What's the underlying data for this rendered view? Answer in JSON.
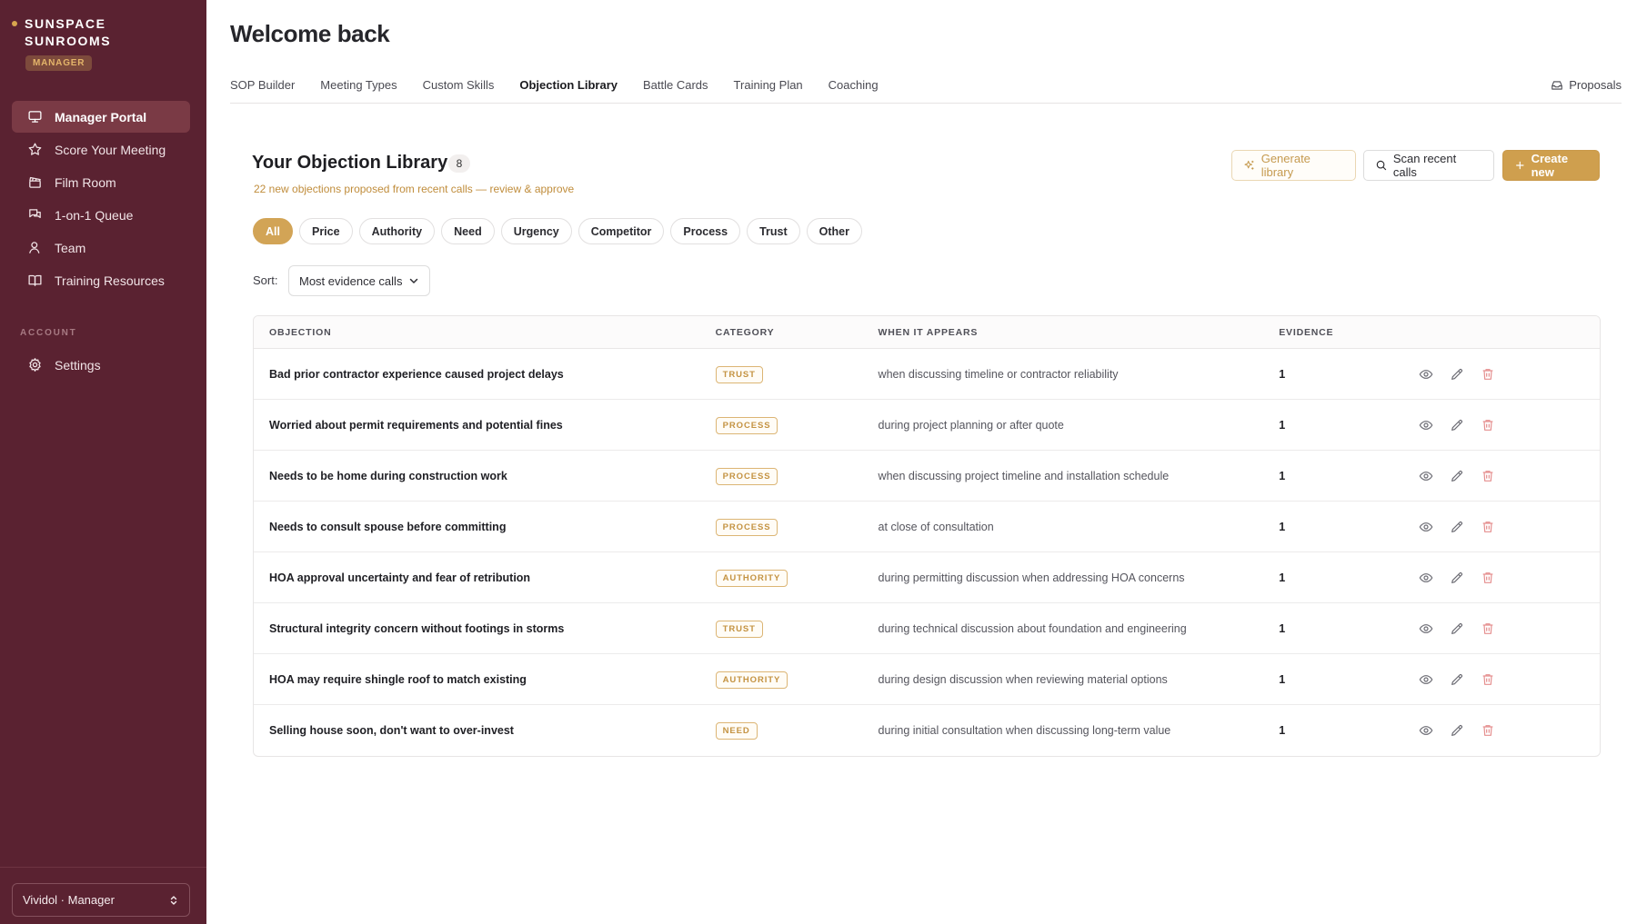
{
  "brand": {
    "name_line1": "SUNSPACE",
    "name_line2": "SUNROOMS",
    "role_badge": "MANAGER"
  },
  "sidebar": {
    "items": [
      {
        "label": "Manager Portal",
        "icon": "monitor-icon",
        "active": true
      },
      {
        "label": "Score Your Meeting",
        "icon": "star-icon"
      },
      {
        "label": "Film Room",
        "icon": "clapperboard-icon"
      },
      {
        "label": "1-on-1 Queue",
        "icon": "chat-icon"
      },
      {
        "label": "Team",
        "icon": "user-icon"
      },
      {
        "label": "Training Resources",
        "icon": "book-icon"
      }
    ],
    "account_label": "ACCOUNT",
    "account_items": [
      {
        "label": "Settings",
        "icon": "gear-icon"
      }
    ],
    "user_switch": "Vividol · Manager"
  },
  "header": {
    "title": "Welcome back"
  },
  "tabs": [
    {
      "label": "SOP Builder"
    },
    {
      "label": "Meeting Types"
    },
    {
      "label": "Custom Skills"
    },
    {
      "label": "Objection Library",
      "active": true
    },
    {
      "label": "Battle Cards"
    },
    {
      "label": "Training Plan"
    },
    {
      "label": "Coaching"
    }
  ],
  "proposals_label": "Proposals",
  "library": {
    "title": "Your Objection Library",
    "count": "8",
    "subtitle": "22 new objections proposed from recent calls — review & approve",
    "generate_label": "Generate library",
    "scan_label": "Scan recent calls",
    "create_label": "Create new"
  },
  "filters": [
    "All",
    "Price",
    "Authority",
    "Need",
    "Urgency",
    "Competitor",
    "Process",
    "Trust",
    "Other"
  ],
  "sort": {
    "label": "Sort:",
    "value": "Most evidence calls"
  },
  "table": {
    "headers": {
      "objection": "OBJECTION",
      "category": "CATEGORY",
      "when": "WHEN IT APPEARS",
      "evidence": "EVIDENCE"
    },
    "rows": [
      {
        "objection": "Bad prior contractor experience caused project delays",
        "category": "TRUST",
        "when": "when discussing timeline or contractor reliability",
        "evidence": "1"
      },
      {
        "objection": "Worried about permit requirements and potential fines",
        "category": "PROCESS",
        "when": "during project planning or after quote",
        "evidence": "1"
      },
      {
        "objection": "Needs to be home during construction work",
        "category": "PROCESS",
        "when": "when discussing project timeline and installation schedule",
        "evidence": "1"
      },
      {
        "objection": "Needs to consult spouse before committing",
        "category": "PROCESS",
        "when": "at close of consultation",
        "evidence": "1"
      },
      {
        "objection": "HOA approval uncertainty and fear of retribution",
        "category": "AUTHORITY",
        "when": "during permitting discussion when addressing HOA concerns",
        "evidence": "1"
      },
      {
        "objection": "Structural integrity concern without footings in storms",
        "category": "TRUST",
        "when": "during technical discussion about foundation and engineering",
        "evidence": "1"
      },
      {
        "objection": "HOA may require shingle roof to match existing",
        "category": "AUTHORITY",
        "when": "during design discussion when reviewing material options",
        "evidence": "1"
      },
      {
        "objection": "Selling house soon, don't want to over-invest",
        "category": "NEED",
        "when": "during initial consultation when discussing long-term value",
        "evidence": "1"
      }
    ]
  },
  "colors": {
    "sidebar_bg": "#5a2231",
    "accent_gold": "#cf9f4e",
    "delete_red": "#e58f8f"
  }
}
